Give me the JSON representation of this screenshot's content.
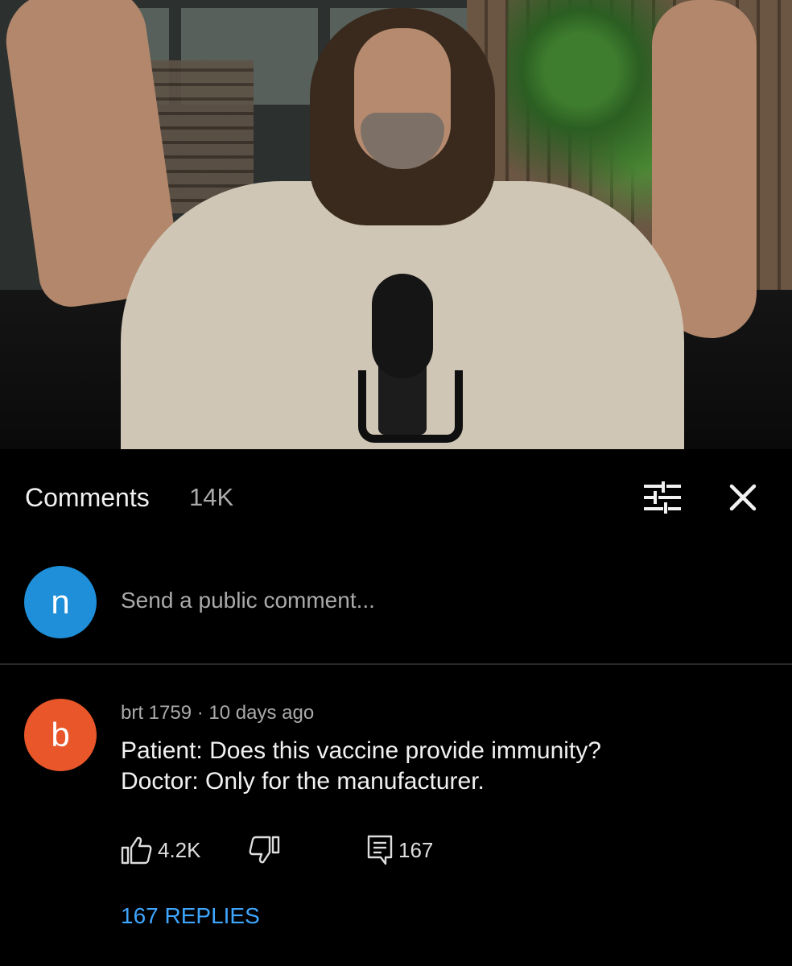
{
  "header": {
    "title": "Comments",
    "count": "14K"
  },
  "compose": {
    "avatar_letter": "n",
    "placeholder": "Send a public comment..."
  },
  "comment": {
    "avatar_letter": "b",
    "author": "brt 1759",
    "separator": "·",
    "time": "10 days ago",
    "lines": [
      "Patient: Does this vaccine provide immunity?",
      "Doctor: Only for the manufacturer."
    ],
    "likes": "4.2K",
    "reply_count": "167",
    "replies_link": "167 REPLIES"
  },
  "colors": {
    "background": "#000000",
    "compose_avatar": "#1e8fd8",
    "comment_avatar": "#e8562a",
    "link": "#3ea6ff",
    "secondary_text": "#aaaaaa"
  },
  "icons": {
    "filter": "sliders-icon",
    "close": "close-icon",
    "like": "thumbs-up-icon",
    "dislike": "thumbs-down-icon",
    "reply": "comment-icon"
  }
}
